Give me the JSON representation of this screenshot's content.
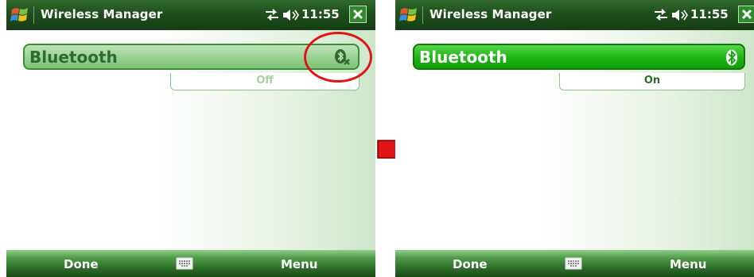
{
  "screens": [
    {
      "title": "Wireless Manager",
      "clock": "11:55",
      "bluetooth": {
        "label": "Bluetooth",
        "status": "Off"
      },
      "softkeys": {
        "left": "Done",
        "right": "Menu"
      }
    },
    {
      "title": "Wireless Manager",
      "clock": "11:55",
      "bluetooth": {
        "label": "Bluetooth",
        "status": "On"
      },
      "softkeys": {
        "left": "Done",
        "right": "Menu"
      }
    }
  ],
  "icons": {
    "start": "windows-flag-icon",
    "connectivity": "connectivity-arrows-icon",
    "volume": "speaker-icon",
    "close": "close-icon",
    "bluetooth_off": "bluetooth-off-icon",
    "bluetooth_on": "bluetooth-icon",
    "keyboard": "keyboard-icon",
    "transition": "right-arrow-icon"
  },
  "colors": {
    "titlebar": "#1f4f1d",
    "bt_off_bar": "#97d191",
    "bt_on_bar": "#20b717",
    "annotation": "#e01515"
  }
}
